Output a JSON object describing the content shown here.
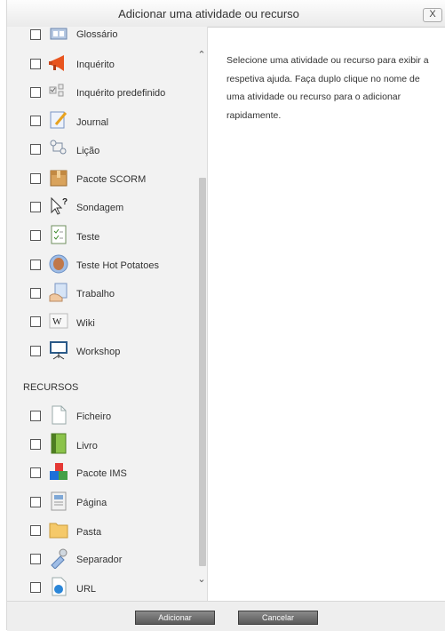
{
  "dialog": {
    "title": "Adicionar uma atividade ou recurso",
    "close_label": "X"
  },
  "activities": [
    {
      "label": "Glossário",
      "icon": "glossary-icon"
    },
    {
      "label": "Inquérito",
      "icon": "megaphone-icon"
    },
    {
      "label": "Inquérito predefinido",
      "icon": "survey-icon"
    },
    {
      "label": "Journal",
      "icon": "journal-icon"
    },
    {
      "label": "Lição",
      "icon": "lesson-icon"
    },
    {
      "label": "Pacote SCORM",
      "icon": "scorm-package-icon"
    },
    {
      "label": "Sondagem",
      "icon": "choice-icon"
    },
    {
      "label": "Teste",
      "icon": "quiz-icon"
    },
    {
      "label": "Teste Hot Potatoes",
      "icon": "hotpotatoes-icon"
    },
    {
      "label": "Trabalho",
      "icon": "assignment-icon"
    },
    {
      "label": "Wiki",
      "icon": "wiki-icon"
    },
    {
      "label": "Workshop",
      "icon": "workshop-icon"
    }
  ],
  "resources_header": "RECURSOS",
  "resources": [
    {
      "label": "Ficheiro",
      "icon": "file-icon"
    },
    {
      "label": "Livro",
      "icon": "book-icon"
    },
    {
      "label": "Pacote IMS",
      "icon": "ims-package-icon"
    },
    {
      "label": "Página",
      "icon": "page-icon"
    },
    {
      "label": "Pasta",
      "icon": "folder-icon"
    },
    {
      "label": "Separador",
      "icon": "label-icon"
    },
    {
      "label": "URL",
      "icon": "url-icon"
    }
  ],
  "help_text": "Selecione uma atividade ou recurso para exibir a respetiva ajuda. Faça duplo clique no nome de uma atividade ou recurso para o adicionar rapidamente.",
  "buttons": {
    "add": "Adicionar",
    "cancel": "Cancelar"
  },
  "colors": {
    "list_background": "#f2f2f2",
    "button_dark": "#5a5a5a"
  }
}
